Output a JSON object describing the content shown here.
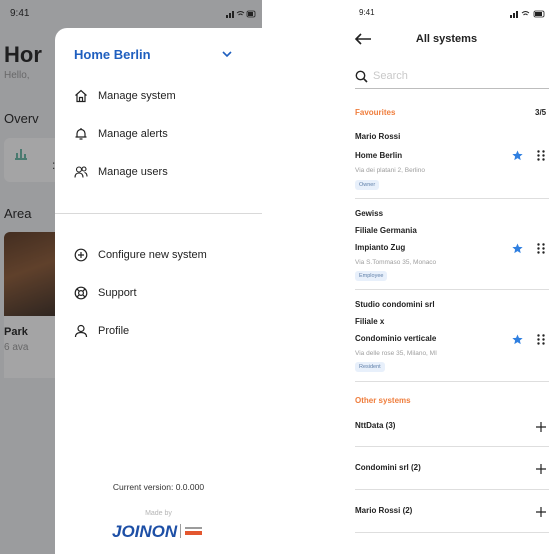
{
  "left_screen": {
    "status_time": "9:41",
    "background": {
      "home_title": "Hor",
      "hello_text": "Hello,",
      "overview_label": "Overv",
      "card_value": ":",
      "area_label": "Area",
      "area_card_title": "Park",
      "area_card_subtitle": "6 ava"
    },
    "drawer": {
      "system_name": "Home Berlin",
      "menu_top": [
        {
          "label": "Manage system",
          "icon": "house-icon"
        },
        {
          "label": "Manage alerts",
          "icon": "bell-icon"
        },
        {
          "label": "Manage users",
          "icon": "users-icon"
        }
      ],
      "menu_bottom": [
        {
          "label": "Configure new system",
          "icon": "plus-circle-icon"
        },
        {
          "label": "Support",
          "icon": "lifebuoy-icon"
        },
        {
          "label": "Profile",
          "icon": "person-icon"
        }
      ],
      "version_text": "Current version: 0.0.000",
      "made_by": "Made by",
      "brand_logo": "JOINON",
      "accent_color": "#1f5fbf"
    }
  },
  "right_screen": {
    "status_time": "9:41",
    "title": "All systems",
    "search_placeholder": "Search",
    "favourites_label": "Favourites",
    "favourites_count": "3/5",
    "favourites": [
      {
        "owner": "Mario Rossi",
        "lines": [
          "Home Berlin"
        ],
        "address": "Via dei platani 2, Berlino",
        "role": "Owner"
      },
      {
        "owner": "Gewiss",
        "lines": [
          "Filiale Germania",
          "Impianto Zug"
        ],
        "address": "Via S.Tommaso 35, Monaco",
        "role": "Employee"
      },
      {
        "owner": "Studio condomini srl",
        "lines": [
          "Filiale x",
          "Condominio verticale"
        ],
        "address": "Via delle rose 35, Milano, MI",
        "role": "Resident"
      }
    ],
    "other_label": "Other systems",
    "other_groups": [
      {
        "label": "NttData (3)"
      },
      {
        "label": "Condomini srl (2)"
      },
      {
        "label": "Mario Rossi (2)"
      }
    ],
    "section_color": "#ef7d3c",
    "star_color": "#2f7fe0"
  }
}
